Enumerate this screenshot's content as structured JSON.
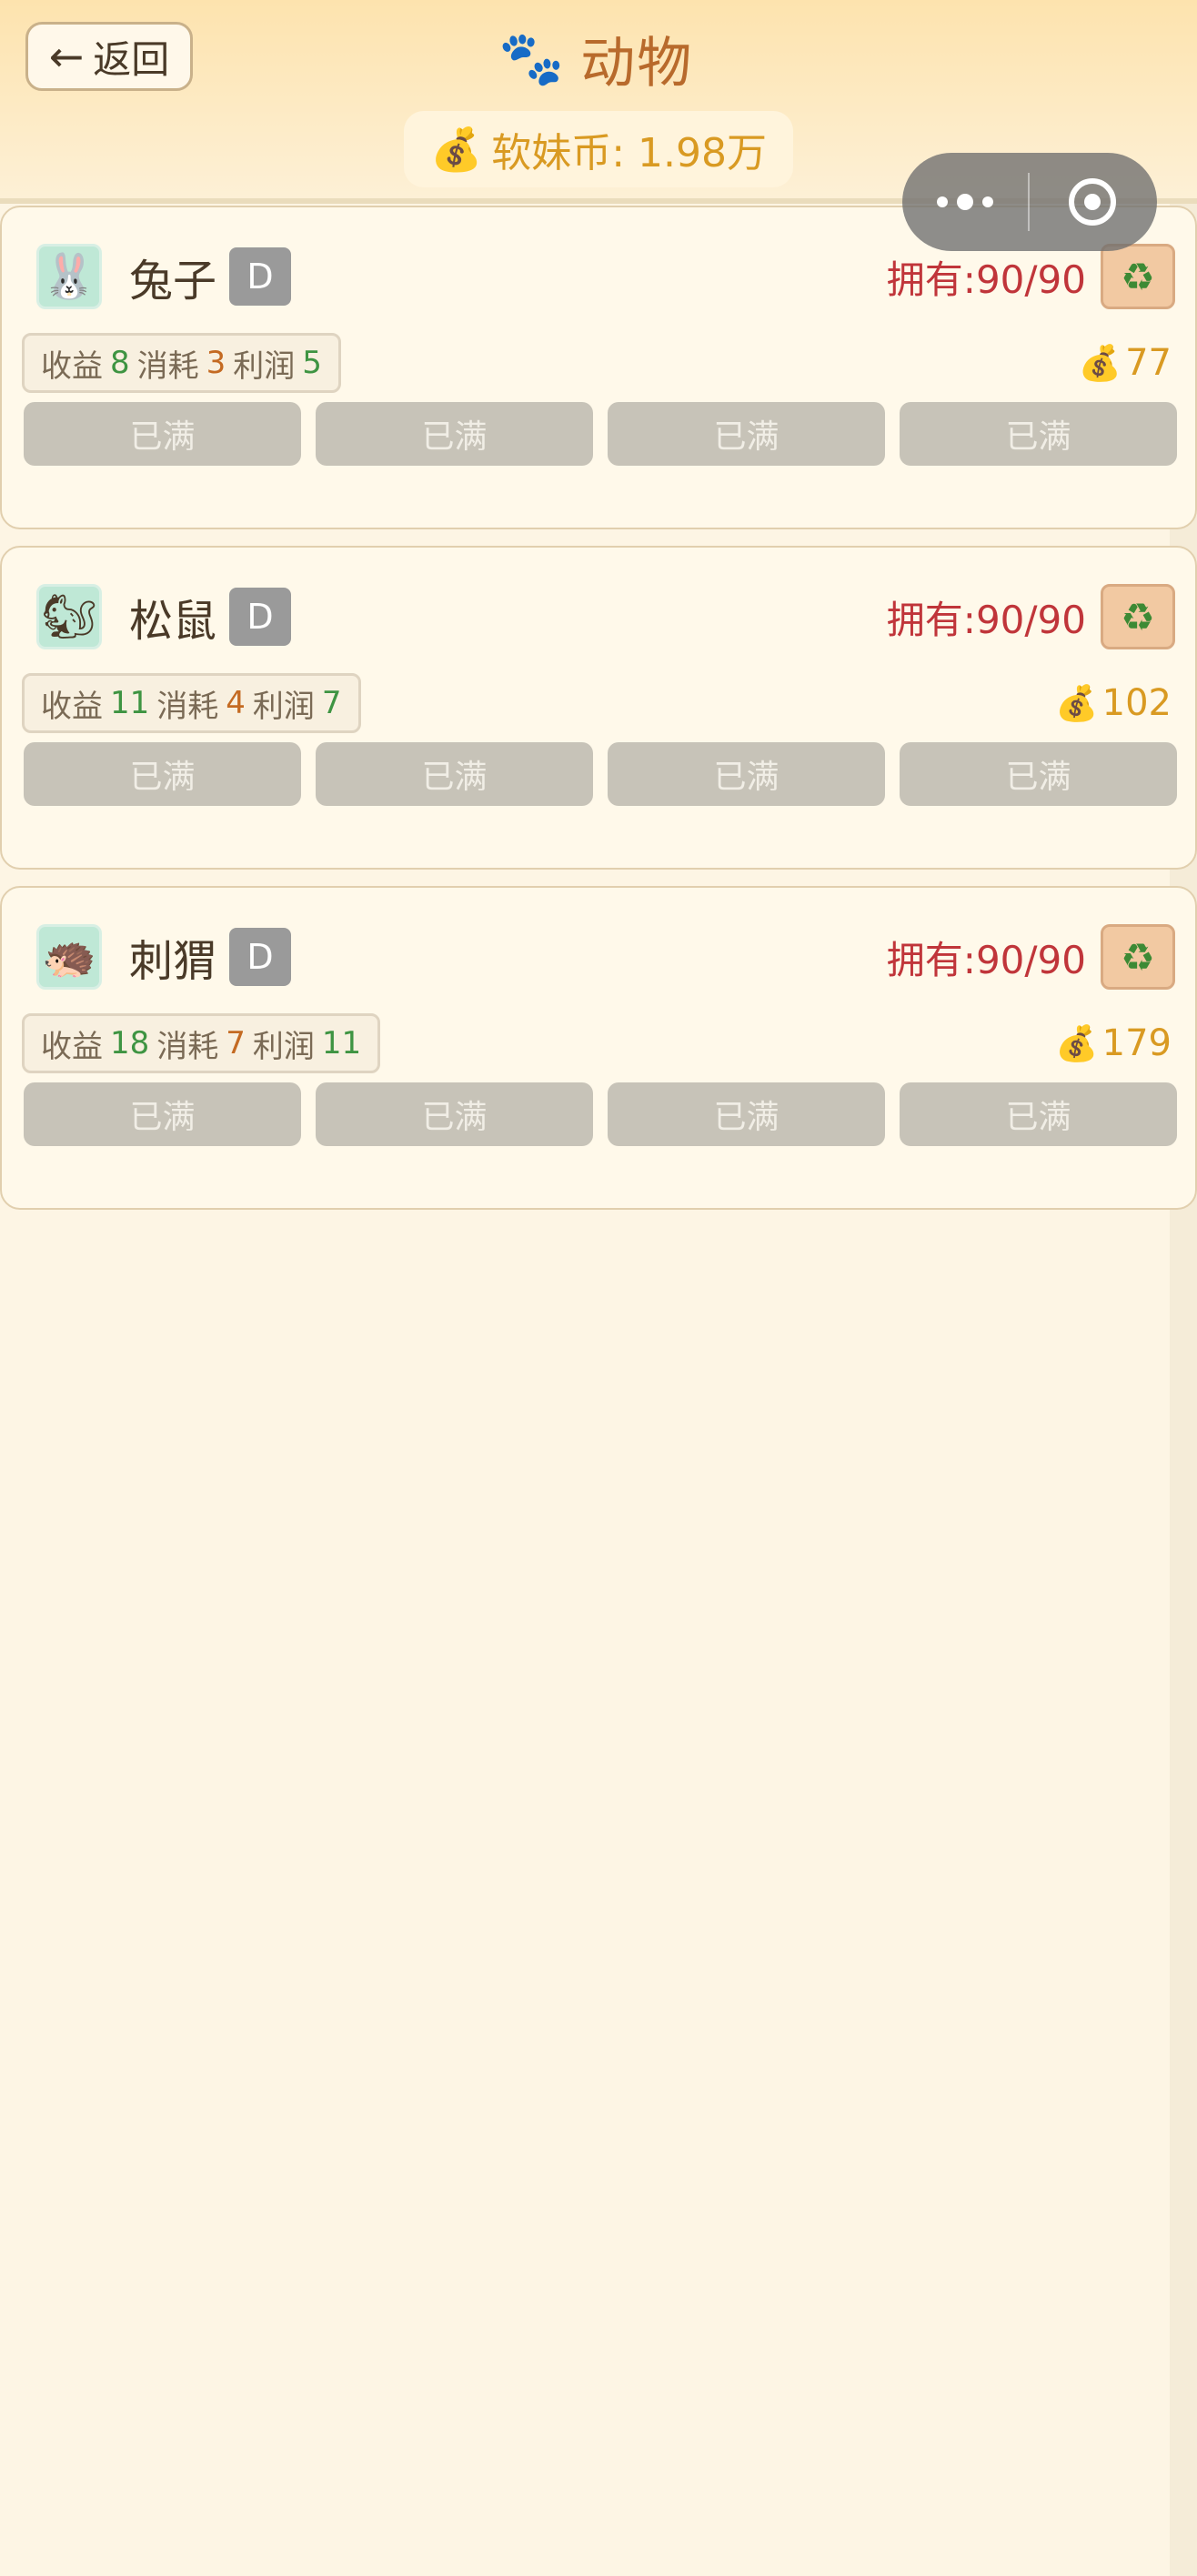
{
  "header": {
    "back_label": "返回",
    "back_arrow": "←",
    "paw_icon": "🐾",
    "title": "动物",
    "coin_icon": "💰",
    "coin_text": "软妹币: 1.98万"
  },
  "animals": [
    {
      "avatar": "🐰",
      "name": "兔子",
      "grade": "D",
      "owned": "拥有:90/90",
      "recycle_icon": "♻",
      "stats": {
        "income_label": "收益",
        "income": "8",
        "cost_label": "消耗",
        "cost": "3",
        "profit_label": "利润",
        "profit": "5"
      },
      "price_icon": "💰",
      "price": "77",
      "buttons": [
        "已满",
        "已满",
        "已满",
        "已满"
      ]
    },
    {
      "avatar": "🐿",
      "name": "松鼠",
      "grade": "D",
      "owned": "拥有:90/90",
      "recycle_icon": "♻",
      "stats": {
        "income_label": "收益",
        "income": "11",
        "cost_label": "消耗",
        "cost": "4",
        "profit_label": "利润",
        "profit": "7"
      },
      "price_icon": "💰",
      "price": "102",
      "buttons": [
        "已满",
        "已满",
        "已满",
        "已满"
      ]
    },
    {
      "avatar": "🦔",
      "name": "刺猬",
      "grade": "D",
      "owned": "拥有:90/90",
      "recycle_icon": "♻",
      "stats": {
        "income_label": "收益",
        "income": "18",
        "cost_label": "消耗",
        "cost": "7",
        "profit_label": "利润",
        "profit": "11"
      },
      "price_icon": "💰",
      "price": "179",
      "buttons": [
        "已满",
        "已满",
        "已满",
        "已满"
      ]
    }
  ],
  "colors": {
    "accent": "#b86a2c",
    "coin": "#d99a22",
    "owned": "#c0353a",
    "stat_green": "#3e9442",
    "stat_orange": "#c46a22",
    "disabled_button": "#c7c3b8"
  }
}
